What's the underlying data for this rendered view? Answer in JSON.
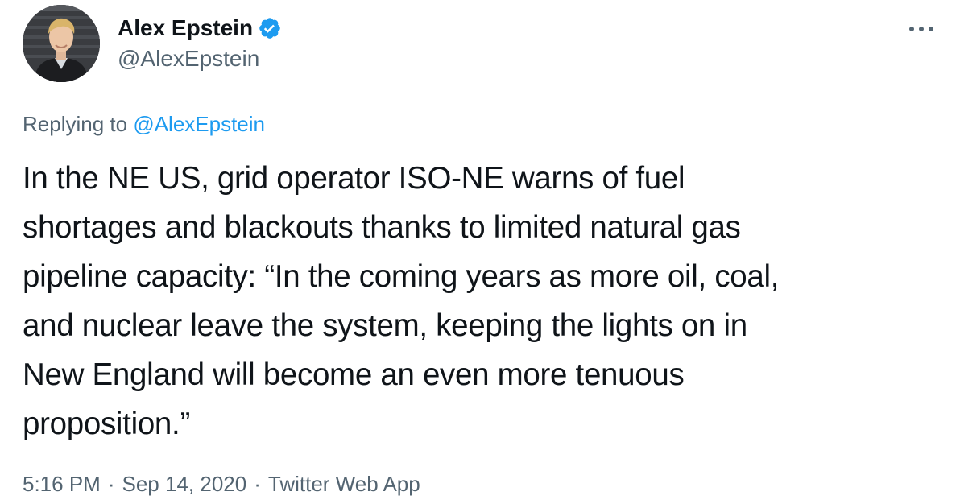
{
  "author": {
    "display_name": "Alex Epstein",
    "handle": "@AlexEpstein",
    "verified": true
  },
  "icons": {
    "verified": "verified-badge-icon",
    "more": "more-dots-icon"
  },
  "reply": {
    "prefix": "Replying to ",
    "handle": "@AlexEpstein"
  },
  "tweet": {
    "lines": [
      "In the NE US, grid operator ISO-NE warns of fuel",
      "shortages and blackouts thanks to limited natural gas",
      "pipeline capacity: “In the coming years as more oil, coal,",
      "and nuclear leave the system, keeping the lights on in",
      "New England will become an even more tenuous",
      "proposition.”"
    ]
  },
  "meta": {
    "time": "5:16 PM",
    "date": "Sep 14, 2020",
    "source": "Twitter Web App",
    "separator": "·"
  },
  "colors": {
    "text": "#0f1419",
    "secondary": "#536471",
    "link": "#1d9bf0",
    "background": "#ffffff"
  }
}
